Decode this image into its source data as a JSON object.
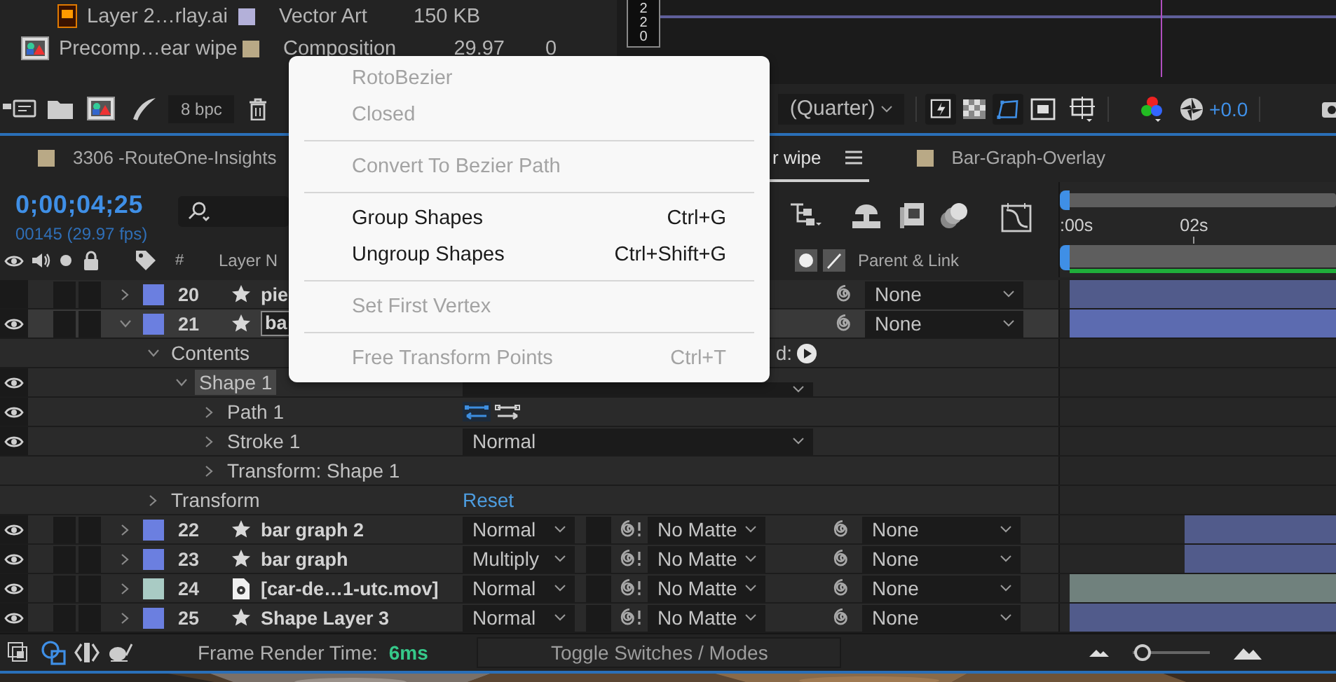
{
  "project": {
    "items": [
      {
        "kind": "illustrator",
        "name": "Layer 2…rlay.ai",
        "color": "#b3b0d9",
        "type": "Vector Art",
        "size": "150 KB"
      },
      {
        "kind": "composition",
        "name": "Precomp…ear wipe",
        "color": "#b9a986",
        "type": "Composition",
        "frame_rate": "29.97",
        "column_5": "0"
      }
    ]
  },
  "viewer": {
    "ruler_digits": [
      "2",
      "2",
      "0"
    ]
  },
  "toolbar": {
    "bit_depth": "8 bpc",
    "resolution": "(Quarter)",
    "exposure": "+0.0"
  },
  "tabs": [
    {
      "label": "3306 -RouteOne-Insights",
      "color": "#b9a986",
      "selected": false
    },
    {
      "label": "r wipe",
      "selected": true
    },
    {
      "label": "Bar-Graph-Overlay",
      "color": "#b9a986",
      "selected": false
    }
  ],
  "timeline": {
    "timecode": "0;00;04;25",
    "frame_info": "00145 (29.97 fps)",
    "ruler_labels": [
      ":00s",
      "02s"
    ],
    "columns": {
      "number": "#",
      "layer_name": "Layer N",
      "parent": "Parent & Link"
    },
    "layers": [
      {
        "number": "20",
        "kind": "shape",
        "name": "pie",
        "color": "#6b7fe0",
        "visible": false,
        "expanded": false,
        "selected": false,
        "renaming": false,
        "parent": "None",
        "level": 1
      },
      {
        "number": "21",
        "kind": "shape",
        "name": "ba",
        "color": "#6b7fe0",
        "visible": true,
        "expanded": true,
        "selected": true,
        "renaming": true,
        "parent": "None",
        "level": 1,
        "children": [
          {
            "name": "Contents",
            "kind": "contents",
            "eye": false,
            "expanded": true,
            "selected": false,
            "add_label": "d:",
            "children": [
              {
                "name": "Shape 1",
                "kind": "group",
                "eye": true,
                "expanded": true,
                "selected": true,
                "children": [
                  {
                    "name": "Path 1",
                    "kind": "path",
                    "eye": true,
                    "expanded": false,
                    "selected": false
                  },
                  {
                    "name": "Stroke 1",
                    "kind": "stroke",
                    "eye": true,
                    "expanded": false,
                    "selected": false,
                    "mode": "Normal"
                  },
                  {
                    "name": "Transform: Shape 1",
                    "kind": "transform",
                    "eye": false,
                    "expanded": false,
                    "selected": false
                  }
                ]
              }
            ]
          },
          {
            "name": "Transform",
            "kind": "transform",
            "eye": false,
            "expanded": false,
            "selected": false,
            "reset": "Reset"
          }
        ]
      },
      {
        "number": "22",
        "kind": "shape",
        "name": "bar graph 2",
        "color": "#6b7fe0",
        "visible": true,
        "expanded": false,
        "selected": false,
        "renaming": false,
        "mode": "Normal",
        "track_matte": "No Matte",
        "parent": "None",
        "level": 0.57
      },
      {
        "number": "23",
        "kind": "shape",
        "name": "bar graph",
        "color": "#6b7fe0",
        "visible": true,
        "expanded": false,
        "selected": false,
        "renaming": false,
        "mode": "Multiply",
        "track_matte": "No Matte",
        "parent": "None",
        "level": 0.57
      },
      {
        "number": "24",
        "kind": "footage",
        "name": "[car-de…1-utc.mov]",
        "color": "#a9cbc4",
        "visible": true,
        "expanded": false,
        "selected": false,
        "renaming": false,
        "mode": "Normal",
        "track_matte": "No Matte",
        "parent": "None",
        "level": 1
      },
      {
        "number": "25",
        "kind": "shape",
        "name": "Shape Layer 3",
        "color": "#6b7fe0",
        "visible": true,
        "expanded": false,
        "selected": false,
        "renaming": false,
        "mode": "Normal",
        "track_matte": "No Matte",
        "parent": "None",
        "level": 1
      }
    ]
  },
  "context_menu": {
    "items": [
      {
        "kind": "item",
        "label": "RotoBezier",
        "disabled": true
      },
      {
        "kind": "item",
        "label": "Closed",
        "disabled": true
      },
      {
        "kind": "separator"
      },
      {
        "kind": "item",
        "label": "Convert To Bezier Path",
        "disabled": true
      },
      {
        "kind": "separator"
      },
      {
        "kind": "item",
        "label": "Group Shapes",
        "shortcut": "Ctrl+G",
        "disabled": false
      },
      {
        "kind": "item",
        "label": "Ungroup Shapes",
        "shortcut": "Ctrl+Shift+G",
        "disabled": false
      },
      {
        "kind": "separator"
      },
      {
        "kind": "item",
        "label": "Set First Vertex",
        "disabled": true
      },
      {
        "kind": "separator"
      },
      {
        "kind": "item",
        "label": "Free Transform Points",
        "shortcut": "Ctrl+T",
        "disabled": true
      }
    ]
  },
  "status_bar": {
    "render_label": "Frame Render Time:",
    "render_time": "6ms",
    "toggle": "Toggle Switches / Modes",
    "zoom": {
      "level": 0.12
    }
  }
}
